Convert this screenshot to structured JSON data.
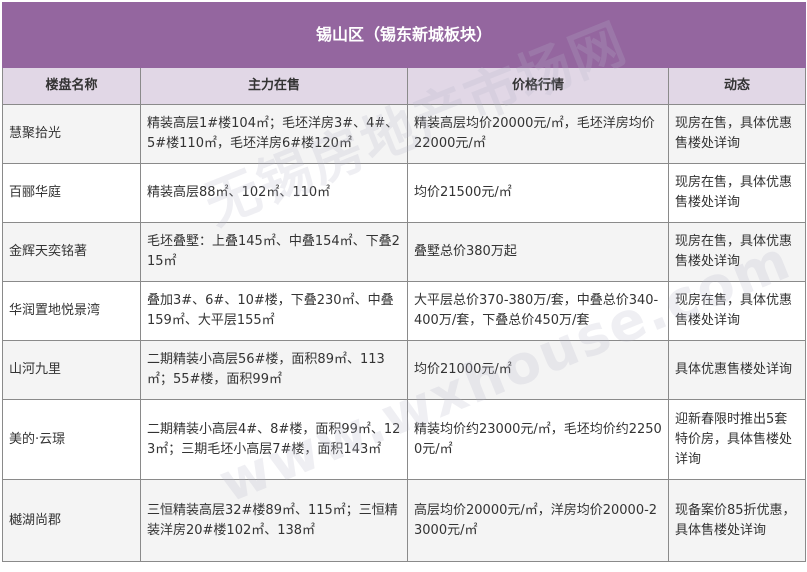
{
  "title": "锡山区（锡东新城板块）",
  "headers": [
    "楼盘名称",
    "主力在售",
    "价格行情",
    "动态"
  ],
  "rows": [
    {
      "name": "慧聚拾光",
      "main": "精装高层1#楼104㎡；毛坯洋房3#、4#、5#楼110㎡，毛坯洋房6#楼120㎡",
      "price": "精装高层均价20000元/㎡，毛坯洋房均价22000元/㎡",
      "status": "现房在售，具体优惠售楼处详询"
    },
    {
      "name": "百郦华庭",
      "main": "精装高层88㎡、102㎡、110㎡",
      "price": "均价21500元/㎡",
      "status": "现房在售，具体优惠售楼处详询"
    },
    {
      "name": "金辉天奕铭著",
      "main": "毛坯叠墅：上叠145㎡、中叠154㎡、下叠215㎡",
      "price": "叠墅总价380万起",
      "status": "现房在售，具体优惠售楼处详询"
    },
    {
      "name": "华润置地悦景湾",
      "main": "叠加3#、6#、10#楼，下叠230㎡、中叠159㎡、大平层155㎡",
      "price": "大平层总价370-380万/套，中叠总价340-400万/套，下叠总价450万/套",
      "status": "现房在售，具体优惠售楼处详询"
    },
    {
      "name": "山河九里",
      "main": "二期精装小高层56#楼，面积89㎡、113㎡；55#楼，面积99㎡",
      "price": "均价21000元/㎡",
      "status": "具体优惠售楼处详询"
    },
    {
      "name": "美的·云璟",
      "main": "二期精装小高层4#、8#楼，面积99㎡、123㎡；三期毛坯小高层7#楼，面积143㎡",
      "price": "精装均价约23000元/㎡，毛坯均价约22500元/㎡",
      "status": "迎新春限时推出5套特价房，具体售楼处详询"
    },
    {
      "name": "樾湖尚郡",
      "main": "三恒精装高层32#楼89㎡、115㎡；三恒精装洋房20#楼102㎡、138㎡",
      "price": "高层均价20000元/㎡，洋房均价20000-23000元/㎡",
      "status": "现备案价85折优惠，具体售楼处详询"
    }
  ],
  "watermark": {
    "line1": "无锡房地产市场网",
    "line2": "www.wxhouse.com"
  }
}
